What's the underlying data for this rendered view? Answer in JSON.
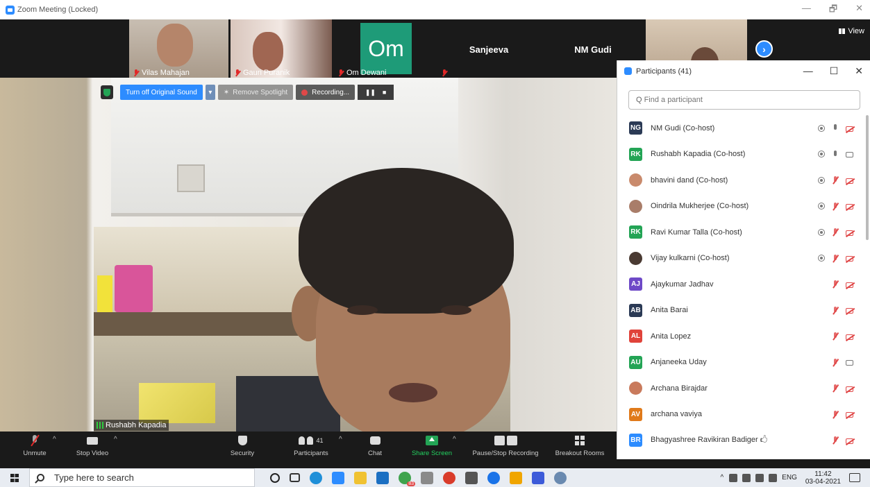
{
  "window": {
    "title": "Zoom Meeting (Locked)",
    "minimize": "—",
    "maximize": "🗗",
    "close": "✕"
  },
  "video_strip": {
    "tiles": [
      {
        "name": "Vilas Mahajan",
        "type": "video",
        "bg": "#b8a898"
      },
      {
        "name": "Gauri Puranik",
        "type": "video",
        "bg": "#8a5c4e"
      },
      {
        "name": "Om Dewani",
        "type": "initials",
        "initials": "Om",
        "bg": "#1e9b78"
      },
      {
        "name": "Sanjeeva",
        "type": "name"
      },
      {
        "name": "NM Gudi",
        "type": "name"
      }
    ],
    "view_label": "View"
  },
  "overlay": {
    "original_sound_label": "Turn off Original Sound",
    "remove_spotlight_label": "Remove Spotlight",
    "recording_label": "Recording...",
    "speaker_name": "Rushabh Kapadia"
  },
  "participants_panel": {
    "title": "Participants (41)",
    "search_placeholder": "Find a participant",
    "participants": [
      {
        "initials": "NG",
        "name": "NM Gudi (Co-host)",
        "color": "#2b3a55",
        "rec": true,
        "mic": "on",
        "video": "off"
      },
      {
        "initials": "RK",
        "name": "Rushabh Kapadia (Co-host)",
        "color": "#23a455",
        "rec": true,
        "mic": "on",
        "video": "on"
      },
      {
        "initials": "",
        "name": "bhavini dand (Co-host)",
        "color": "#c98a6c",
        "photo": true,
        "rec": true,
        "mic": "off",
        "video": "off"
      },
      {
        "initials": "",
        "name": "Oindrila Mukherjee (Co-host)",
        "color": "#a97d69",
        "photo": true,
        "rec": true,
        "mic": "off",
        "video": "off"
      },
      {
        "initials": "RK",
        "name": "Ravi Kumar Talla (Co-host)",
        "color": "#23a455",
        "rec": true,
        "mic": "off",
        "video": "off"
      },
      {
        "initials": "",
        "name": "Vijay kulkarni (Co-host)",
        "color": "#4a3a32",
        "photo": true,
        "rec": true,
        "mic": "off",
        "video": "off"
      },
      {
        "initials": "AJ",
        "name": "Ajaykumar Jadhav",
        "color": "#6e49c7",
        "rec": false,
        "mic": "off",
        "video": "off"
      },
      {
        "initials": "AB",
        "name": "Anita Barai",
        "color": "#2b3a55",
        "rec": false,
        "mic": "off",
        "video": "off"
      },
      {
        "initials": "AL",
        "name": "Anita Lopez",
        "color": "#e0433a",
        "rec": false,
        "mic": "off",
        "video": "off"
      },
      {
        "initials": "AU",
        "name": "Anjaneeka Uday",
        "color": "#23a455",
        "rec": false,
        "mic": "off",
        "video": "on"
      },
      {
        "initials": "",
        "name": "Archana Birajdar",
        "color": "#c97a5c",
        "photo": true,
        "rec": false,
        "mic": "off",
        "video": "off"
      },
      {
        "initials": "AV",
        "name": "archana vaviya",
        "color": "#e07a1a",
        "rec": false,
        "mic": "off",
        "video": "off"
      },
      {
        "initials": "BR",
        "name": "Bhagyashree Ravikiran Badiger 🖒",
        "color": "#2d8cff",
        "rec": false,
        "mic": "off",
        "video": "off"
      }
    ]
  },
  "toolbar": {
    "unmute": "Unmute",
    "stop_video": "Stop Video",
    "security": "Security",
    "participants": "Participants",
    "participants_count": "41",
    "chat": "Chat",
    "share_screen": "Share Screen",
    "pause_stop_recording": "Pause/Stop Recording",
    "breakout_rooms": "Breakout Rooms",
    "share_color": "#23a455"
  },
  "taskbar": {
    "search_placeholder": "Type here to search",
    "language": "ENG",
    "time": "11:42",
    "date": "03-04-2021",
    "mail_badge": "83"
  }
}
